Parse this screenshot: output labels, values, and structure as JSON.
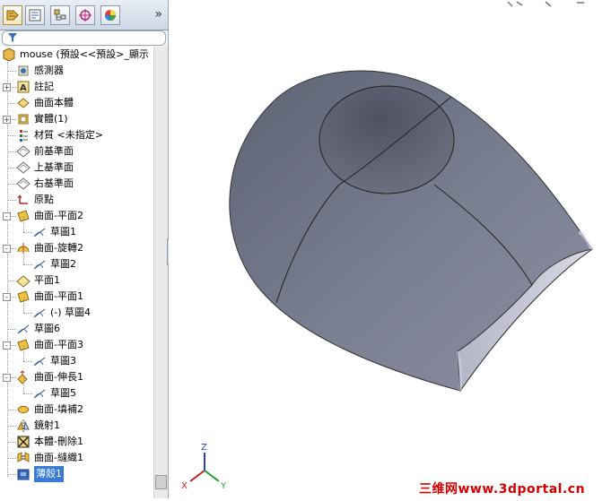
{
  "feature_manager": {
    "tabs": [
      {
        "name": "feature-manager-tab-icon",
        "active": true
      },
      {
        "name": "property-manager-tab-icon",
        "active": false
      },
      {
        "name": "configuration-manager-tab-icon",
        "active": false
      },
      {
        "name": "dimxpert-manager-tab-icon",
        "active": false
      },
      {
        "name": "display-manager-tab-icon",
        "active": false
      }
    ],
    "more_glyph": "»",
    "filter_icon": "filter-icon",
    "tree": [
      {
        "label": "mouse  (預設<<預設>_顯示",
        "icon": "part-icon",
        "level": 0,
        "expander": null
      },
      {
        "label": "感測器",
        "icon": "sensor-icon",
        "level": 1,
        "expander": null
      },
      {
        "label": "註記",
        "icon": "annotation-icon",
        "level": 1,
        "expander": "+"
      },
      {
        "label": "曲面本體",
        "icon": "surface-body-icon",
        "level": 1,
        "expander": null
      },
      {
        "label": "實體(1)",
        "icon": "solid-body-icon",
        "level": 1,
        "expander": "+"
      },
      {
        "label": "材質 <未指定>",
        "icon": "material-icon",
        "level": 1,
        "expander": null
      },
      {
        "label": "前基準面",
        "icon": "plane-icon",
        "level": 1,
        "expander": null
      },
      {
        "label": "上基準面",
        "icon": "plane-icon",
        "level": 1,
        "expander": null
      },
      {
        "label": "右基準面",
        "icon": "plane-icon",
        "level": 1,
        "expander": null
      },
      {
        "label": "原點",
        "icon": "origin-icon",
        "level": 1,
        "expander": null
      },
      {
        "label": "曲面-平面2",
        "icon": "planar-surface-icon",
        "level": 1,
        "expander": "-"
      },
      {
        "label": "草圖1",
        "icon": "sketch-icon",
        "level": 2,
        "expander": null
      },
      {
        "label": "曲面-旋轉2",
        "icon": "revolve-surface-icon",
        "level": 1,
        "expander": "-"
      },
      {
        "label": "草圖2",
        "icon": "sketch-icon",
        "level": 2,
        "expander": null
      },
      {
        "label": "平面1",
        "icon": "plane1-icon",
        "level": 1,
        "expander": null
      },
      {
        "label": "曲面-平面1",
        "icon": "planar-surface-icon",
        "level": 1,
        "expander": "-"
      },
      {
        "label": "(-) 草圖4",
        "icon": "sketch-icon",
        "level": 2,
        "expander": null
      },
      {
        "label": "草圖6",
        "icon": "sketch-icon",
        "level": 1,
        "expander": null
      },
      {
        "label": "曲面-平面3",
        "icon": "planar-surface-icon",
        "level": 1,
        "expander": "-"
      },
      {
        "label": "草圖3",
        "icon": "sketch-icon",
        "level": 2,
        "expander": null
      },
      {
        "label": "曲面-伸長1",
        "icon": "extrude-surface-icon",
        "level": 1,
        "expander": "-"
      },
      {
        "label": "草圖5",
        "icon": "sketch-icon",
        "level": 2,
        "expander": null
      },
      {
        "label": "曲面-填補2",
        "icon": "fill-surface-icon",
        "level": 1,
        "expander": null
      },
      {
        "label": "鏡射1",
        "icon": "mirror-icon",
        "level": 1,
        "expander": null
      },
      {
        "label": "本體-刪除1",
        "icon": "delete-body-icon",
        "level": 1,
        "expander": null
      },
      {
        "label": "曲面-縫織1",
        "icon": "knit-surface-icon",
        "level": 1,
        "expander": null
      },
      {
        "label": "薄殼1",
        "icon": "shell-icon",
        "level": 1,
        "expander": null,
        "selected": true
      }
    ]
  },
  "triad": {
    "x": "X",
    "y": "Y",
    "z": "Z"
  },
  "watermark": "三维网www.3dportal.cn",
  "colors": {
    "model": "#6a6f80",
    "selection": "#3a7bd5",
    "watermark": "#d40000"
  }
}
